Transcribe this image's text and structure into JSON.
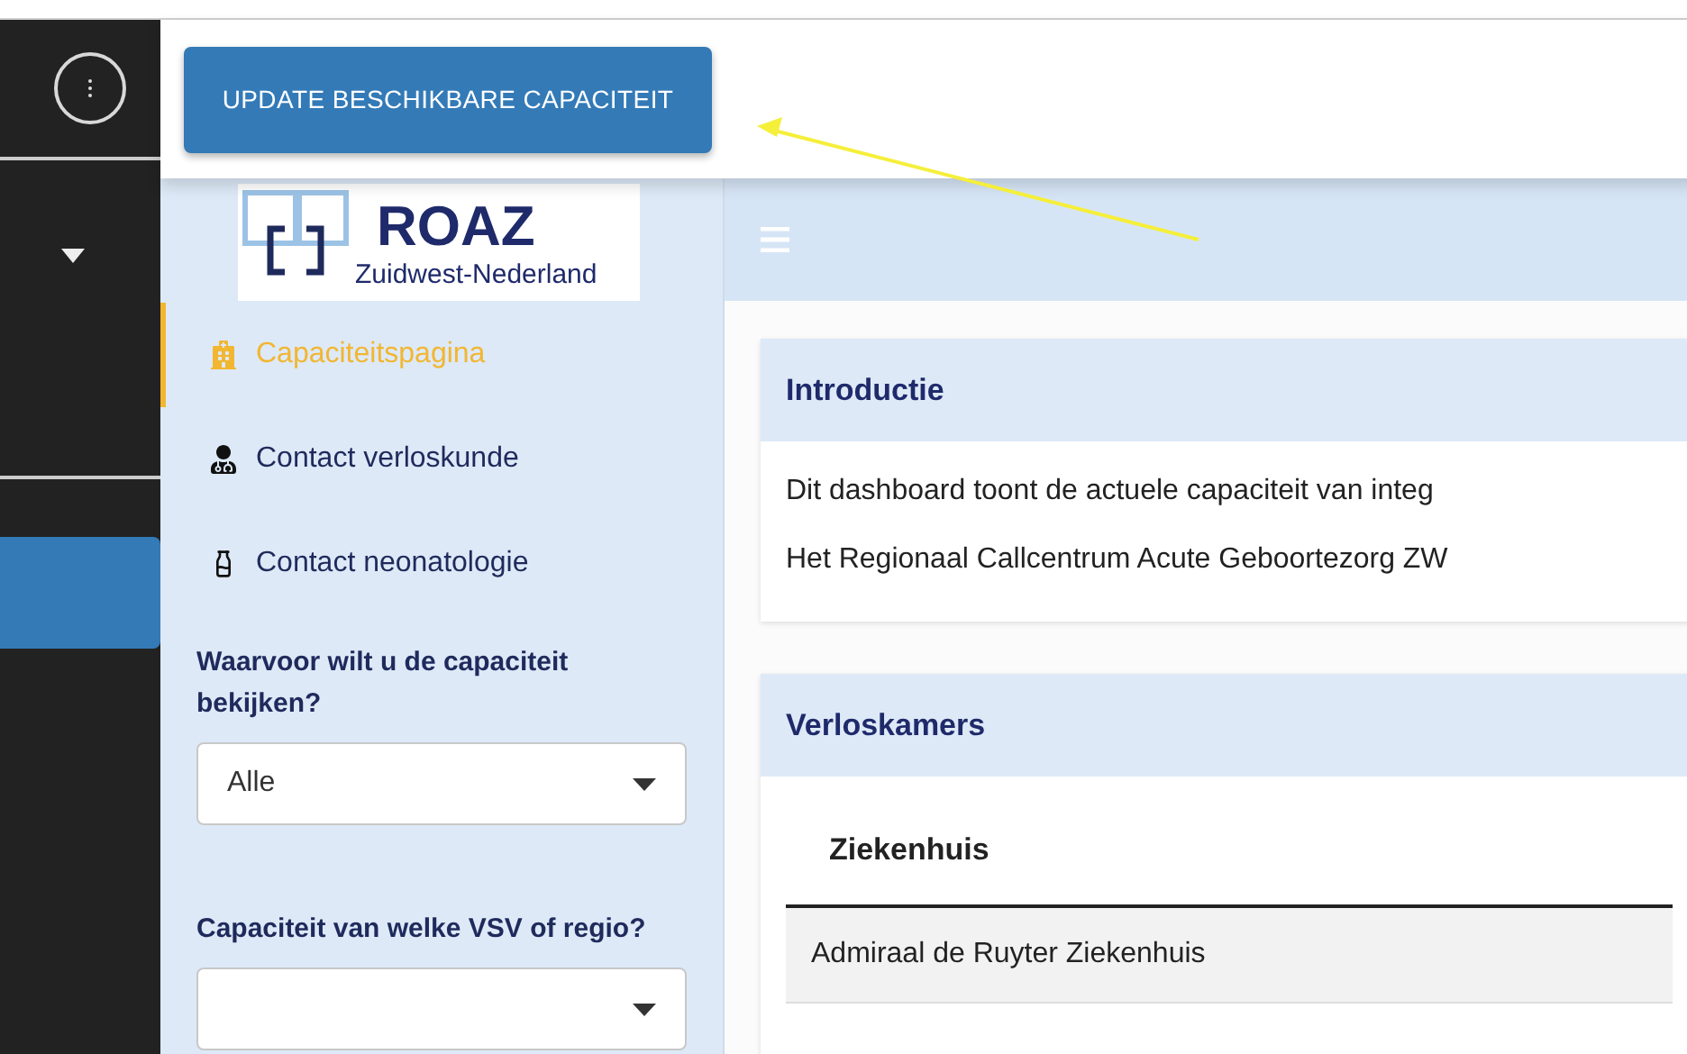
{
  "top_bar": {
    "button": "UPDATE BESCHIKBARE CAPACITEIT"
  },
  "logo": {
    "title": "ROAZ",
    "subtitle": "Zuidwest-Nederland"
  },
  "nav": [
    {
      "label": "Capaciteitspagina",
      "kind": "hospital",
      "selected": true
    },
    {
      "label": "Contact verloskunde",
      "kind": "doctor",
      "selected": false
    },
    {
      "label": "Contact neonatologie",
      "kind": "bottle",
      "selected": false
    }
  ],
  "filters": [
    {
      "label": "Waarvoor wilt u de capaciteit bekijken?",
      "value": "Alle"
    },
    {
      "label": "Capaciteit van welke VSV of regio?"
    }
  ],
  "cards": [
    {
      "title": "Introductie",
      "paragraphs": [
        "Dit dashboard toont de actuele capaciteit van integ",
        "Het Regionaal Callcentrum Acute Geboortezorg ZW"
      ]
    },
    {
      "title": "Verloskamers",
      "table": {
        "columns": [
          "Ziekenhuis"
        ],
        "rows": [
          [
            "Admiraal de Ruyter Ziekenhuis"
          ]
        ]
      }
    }
  ]
}
